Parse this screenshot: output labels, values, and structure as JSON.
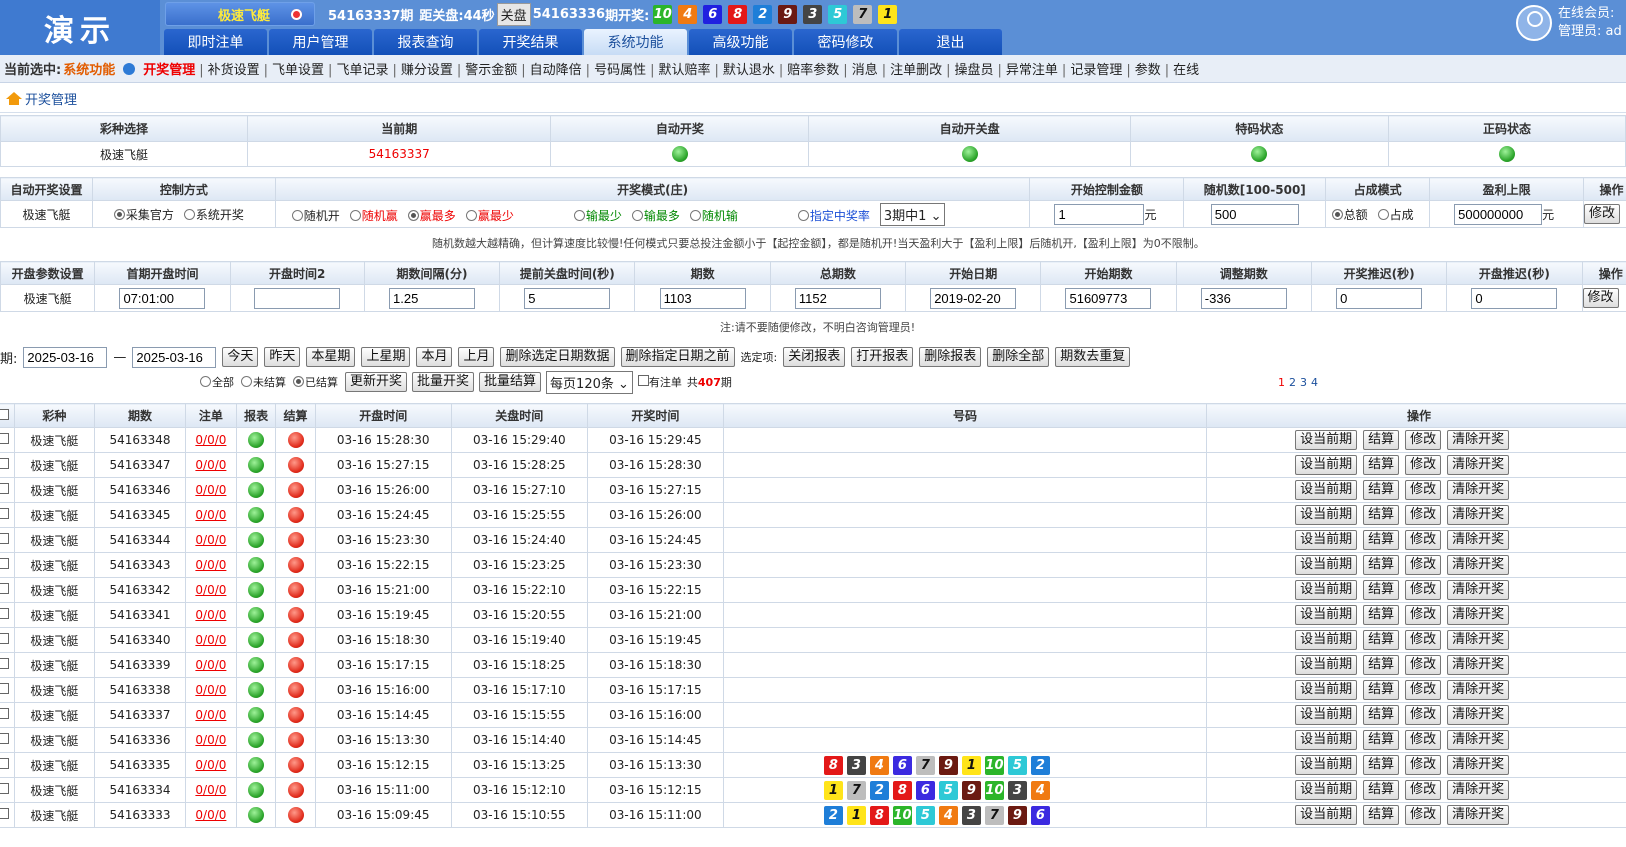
{
  "brand": {
    "logo": "演示"
  },
  "game_select": {
    "label": "极速飞艇"
  },
  "info": {
    "period": "54163337期",
    "countdown_label": "距关盘:",
    "countdown": "44秒",
    "close_btn": "关盘",
    "last_period": "54163336",
    "last_label": "期开奖:"
  },
  "last_draw": [
    {
      "n": "10",
      "c": "#2bb52a"
    },
    {
      "n": "4",
      "c": "#f07a12"
    },
    {
      "n": "6",
      "c": "#2020e0"
    },
    {
      "n": "8",
      "c": "#e31818"
    },
    {
      "n": "2",
      "c": "#1e7ed8"
    },
    {
      "n": "9",
      "c": "#6b1a12"
    },
    {
      "n": "3",
      "c": "#444444"
    },
    {
      "n": "5",
      "c": "#2ec9d6"
    },
    {
      "n": "7",
      "c": "#bdbdbd"
    },
    {
      "n": "1",
      "c": "#ffe41a"
    }
  ],
  "tabs": [
    "即时注单",
    "用户管理",
    "报表查询",
    "开奖结果",
    "系统功能",
    "高级功能",
    "密码修改",
    "退出"
  ],
  "active_tab": 4,
  "user": {
    "online": "在线会员:",
    "admin": "管理员: ad"
  },
  "subnav": {
    "current_label": "当前选中:",
    "module": "系统功能",
    "items": [
      "开奖管理",
      "补货设置",
      "飞单设置",
      "飞单记录",
      "赚分设置",
      "警示金额",
      "自动降倍",
      "号码属性",
      "默认赔率",
      "默认退水",
      "赔率参数",
      "消息",
      "注单删改",
      "操盘员",
      "异常注单",
      "记录管理",
      "参数",
      "在线"
    ]
  },
  "breadcrumb": "开奖管理",
  "status_table": {
    "headers": [
      "彩种选择",
      "当前期",
      "自动开奖",
      "自动开关盘",
      "特码状态",
      "正码状态"
    ],
    "game": "极速飞艇",
    "period": "54163337"
  },
  "auto_table": {
    "headers": [
      "自动开奖设置",
      "控制方式",
      "开奖模式(庄)",
      "开始控制金额",
      "随机数[100-500]",
      "占成模式",
      "盈利上限",
      "操作"
    ],
    "game": "极速飞艇",
    "control": [
      "采集官方",
      "系统开奖"
    ],
    "modes": [
      "随机开",
      "随机赢",
      "赢最多",
      "赢最少",
      "输最少",
      "输最多",
      "随机输",
      "指定中奖率"
    ],
    "mode_select": "3期中1",
    "amount": "1",
    "unit": "元",
    "random": "500",
    "share": [
      "总额",
      "占成"
    ],
    "profit": "500000000",
    "op": "修改",
    "note": "随机数越大越精确，但计算速度比较慢!任何模式只要总投注金额小于【起控金额】，都是随机开!当天盈利大于【盈利上限】后随机开,【盈利上限】为0不限制。"
  },
  "param_table": {
    "headers": [
      "开盘参数设置",
      "首期开盘时间",
      "开盘时间2",
      "期数间隔(分)",
      "提前关盘时间(秒)",
      "期数",
      "总期数",
      "开始日期",
      "开始期数",
      "调整期数",
      "开奖推迟(秒)",
      "开盘推迟(秒)",
      "操作"
    ],
    "game": "极速飞艇",
    "values": [
      "07:01:00",
      "",
      "1.25",
      "5",
      "1103",
      "1152",
      "2019-02-20",
      "51609773",
      "-336",
      "0",
      "0"
    ],
    "op": "修改",
    "note": "注:请不要随便修改，不明白咨询管理员!"
  },
  "filter": {
    "date_label": "期:",
    "from": "2025-03-16",
    "dash": "—",
    "to": "2025-03-16",
    "buttons": [
      "今天",
      "昨天",
      "本星期",
      "上星期",
      "本月",
      "上月",
      "删除选定日期数据",
      "删除指定日期之前"
    ],
    "opt_label": "选定项:",
    "opt_buttons": [
      "关闭报表",
      "打开报表",
      "删除报表",
      "删除全部",
      "期数去重复"
    ]
  },
  "filter2": {
    "radios": [
      "全部",
      "未结算",
      "已结算"
    ],
    "buttons": [
      "更新开奖",
      "批量开奖",
      "批量结算"
    ],
    "page_size": "每页120条",
    "has_bet": "有注单",
    "total_pre": "共",
    "total": "407",
    "total_post": "期",
    "pages": [
      "1",
      "2",
      "3",
      "4"
    ]
  },
  "list": {
    "headers": [
      "彩种",
      "期数",
      "注单",
      "报表",
      "结算",
      "开盘时间",
      "关盘时间",
      "开奖时间",
      "号码",
      "操作"
    ],
    "actions": [
      "设当前期",
      "结算",
      "修改",
      "清除开奖"
    ],
    "rows": [
      {
        "game": "极速飞艇",
        "period": "54163348",
        "bets": "0/0/0",
        "open": "03-16 15:28:30",
        "close": "03-16 15:29:40",
        "draw": "03-16 15:29:45",
        "nums": []
      },
      {
        "game": "极速飞艇",
        "period": "54163347",
        "bets": "0/0/0",
        "open": "03-16 15:27:15",
        "close": "03-16 15:28:25",
        "draw": "03-16 15:28:30",
        "nums": []
      },
      {
        "game": "极速飞艇",
        "period": "54163346",
        "bets": "0/0/0",
        "open": "03-16 15:26:00",
        "close": "03-16 15:27:10",
        "draw": "03-16 15:27:15",
        "nums": []
      },
      {
        "game": "极速飞艇",
        "period": "54163345",
        "bets": "0/0/0",
        "open": "03-16 15:24:45",
        "close": "03-16 15:25:55",
        "draw": "03-16 15:26:00",
        "nums": []
      },
      {
        "game": "极速飞艇",
        "period": "54163344",
        "bets": "0/0/0",
        "open": "03-16 15:23:30",
        "close": "03-16 15:24:40",
        "draw": "03-16 15:24:45",
        "nums": []
      },
      {
        "game": "极速飞艇",
        "period": "54163343",
        "bets": "0/0/0",
        "open": "03-16 15:22:15",
        "close": "03-16 15:23:25",
        "draw": "03-16 15:23:30",
        "nums": []
      },
      {
        "game": "极速飞艇",
        "period": "54163342",
        "bets": "0/0/0",
        "open": "03-16 15:21:00",
        "close": "03-16 15:22:10",
        "draw": "03-16 15:22:15",
        "nums": []
      },
      {
        "game": "极速飞艇",
        "period": "54163341",
        "bets": "0/0/0",
        "open": "03-16 15:19:45",
        "close": "03-16 15:20:55",
        "draw": "03-16 15:21:00",
        "nums": []
      },
      {
        "game": "极速飞艇",
        "period": "54163340",
        "bets": "0/0/0",
        "open": "03-16 15:18:30",
        "close": "03-16 15:19:40",
        "draw": "03-16 15:19:45",
        "nums": []
      },
      {
        "game": "极速飞艇",
        "period": "54163339",
        "bets": "0/0/0",
        "open": "03-16 15:17:15",
        "close": "03-16 15:18:25",
        "draw": "03-16 15:18:30",
        "nums": []
      },
      {
        "game": "极速飞艇",
        "period": "54163338",
        "bets": "0/0/0",
        "open": "03-16 15:16:00",
        "close": "03-16 15:17:10",
        "draw": "03-16 15:17:15",
        "nums": []
      },
      {
        "game": "极速飞艇",
        "period": "54163337",
        "bets": "0/0/0",
        "open": "03-16 15:14:45",
        "close": "03-16 15:15:55",
        "draw": "03-16 15:16:00",
        "nums": []
      },
      {
        "game": "极速飞艇",
        "period": "54163336",
        "bets": "0/0/0",
        "open": "03-16 15:13:30",
        "close": "03-16 15:14:40",
        "draw": "03-16 15:14:45",
        "nums": []
      },
      {
        "game": "极速飞艇",
        "period": "54163335",
        "bets": "0/0/0",
        "open": "03-16 15:12:15",
        "close": "03-16 15:13:25",
        "draw": "03-16 15:13:30",
        "nums": [
          "8",
          "3",
          "4",
          "6",
          "7",
          "9",
          "1",
          "10",
          "5",
          "2"
        ]
      },
      {
        "game": "极速飞艇",
        "period": "54163334",
        "bets": "0/0/0",
        "open": "03-16 15:11:00",
        "close": "03-16 15:12:10",
        "draw": "03-16 15:12:15",
        "nums": [
          "1",
          "7",
          "2",
          "8",
          "6",
          "5",
          "9",
          "10",
          "3",
          "4"
        ]
      },
      {
        "game": "极速飞艇",
        "period": "54163333",
        "bets": "0/0/0",
        "open": "03-16 15:09:45",
        "close": "03-16 15:10:55",
        "draw": "03-16 15:11:00",
        "nums": [
          "2",
          "1",
          "8",
          "10",
          "5",
          "4",
          "3",
          "7",
          "9",
          "6"
        ]
      }
    ]
  },
  "ball_colors": {
    "1": "#ffe41a",
    "2": "#1e7ed8",
    "3": "#444444",
    "4": "#f07a12",
    "5": "#2ec9d6",
    "6": "#3b2ae0",
    "7": "#bdbdbd",
    "8": "#e31818",
    "9": "#6b1a12",
    "10": "#2bb52a"
  }
}
